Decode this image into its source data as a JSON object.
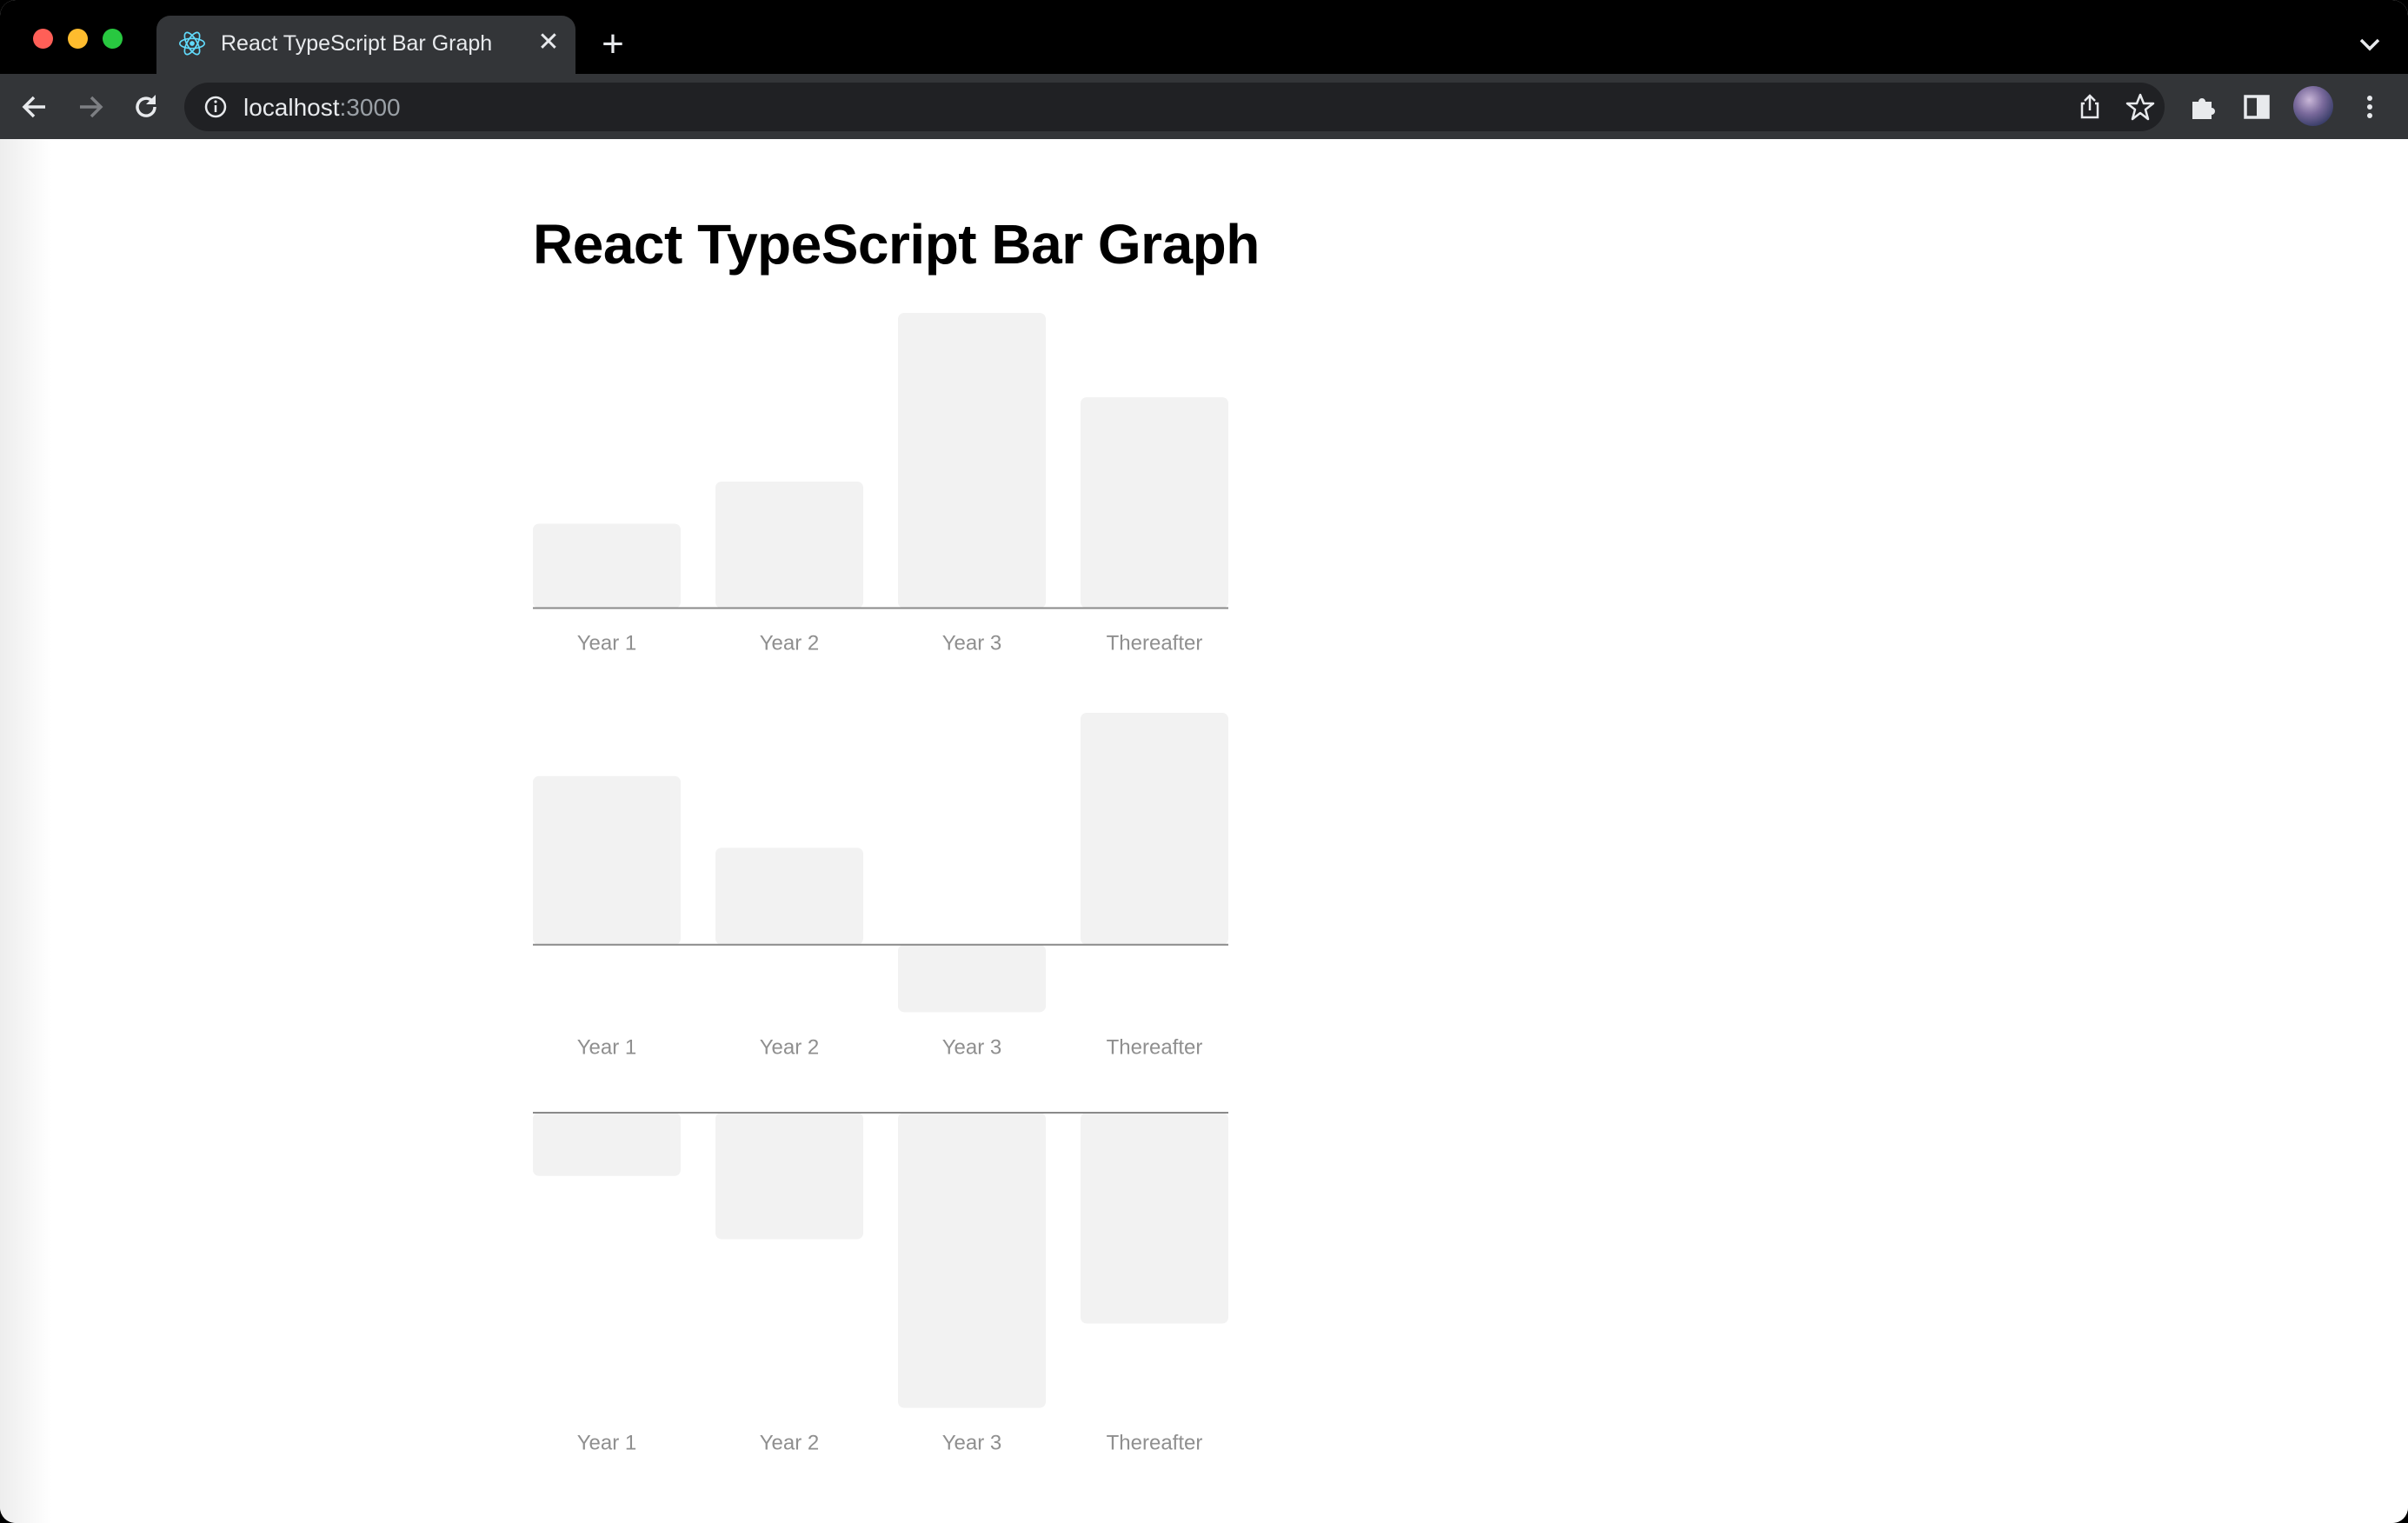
{
  "browser": {
    "tab_title": "React TypeScript Bar Graph",
    "url_host": "localhost",
    "url_port": ":3000",
    "icons": [
      "react-icon",
      "close-icon",
      "plus-icon",
      "chevron-down-icon",
      "back-icon",
      "forward-icon",
      "reload-icon",
      "info-icon",
      "share-icon",
      "star-icon",
      "extensions-icon",
      "side-panel-icon",
      "avatar",
      "more-icon"
    ]
  },
  "page": {
    "title": "React TypeScript Bar Graph"
  },
  "colors": {
    "bar": "#f2f2f2",
    "axis": "#8a8a8a",
    "label": "#8f8f8f"
  },
  "chart_data": [
    {
      "type": "bar",
      "categories": [
        "Year 1",
        "Year 2",
        "Year 3",
        "Thereafter"
      ],
      "values": [
        2,
        3,
        7,
        5
      ]
    },
    {
      "type": "bar",
      "categories": [
        "Year 1",
        "Year 2",
        "Year 3",
        "Thereafter"
      ],
      "values": [
        4,
        2.3,
        -1.6,
        5.5
      ]
    },
    {
      "type": "bar",
      "categories": [
        "Year 1",
        "Year 2",
        "Year 3",
        "Thereafter"
      ],
      "values": [
        -1.5,
        -3,
        -7,
        -5
      ]
    }
  ]
}
